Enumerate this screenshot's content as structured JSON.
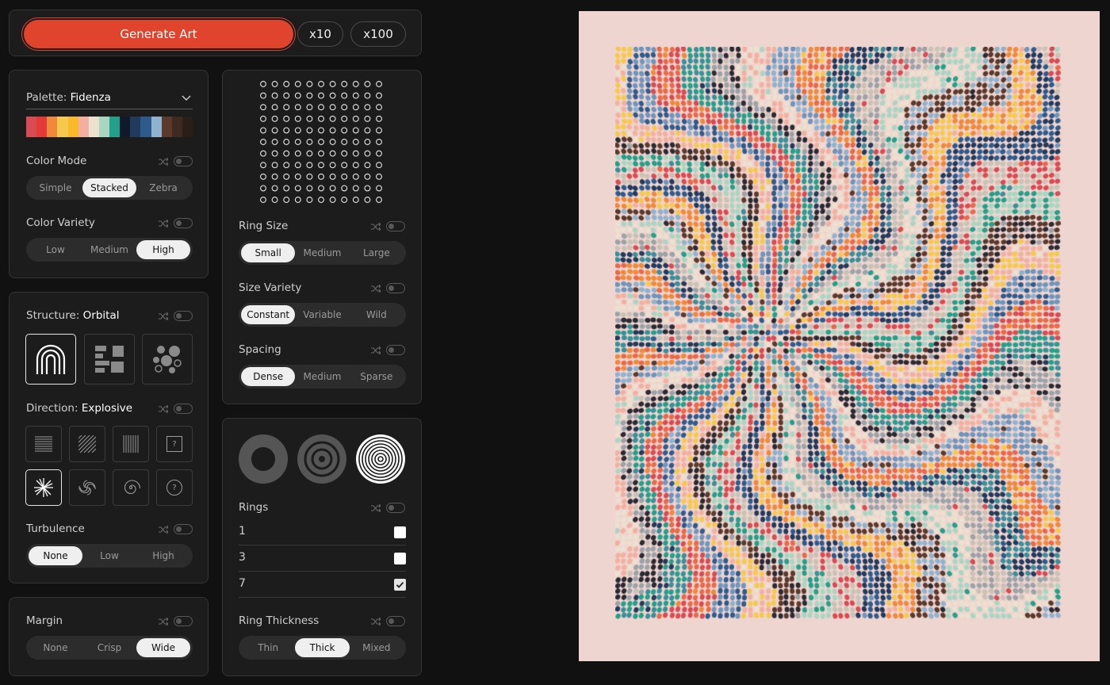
{
  "toolbar": {
    "generate_label": "Generate Art",
    "x10_label": "x10",
    "x100_label": "x100"
  },
  "palette": {
    "label": "Palette:",
    "value": "Fidenza",
    "swatches": [
      "#d94b52",
      "#e23a36",
      "#ef8a3a",
      "#f6c94e",
      "#f9b928",
      "#f2b1a0",
      "#ece0cf",
      "#a9d6c3",
      "#23a08a",
      "#101a2a",
      "#223a5c",
      "#2f5b8c",
      "#8fb3cf",
      "#5b3a2c",
      "#3f2a20",
      "#2a1e18"
    ]
  },
  "color_mode": {
    "label": "Color Mode",
    "options": [
      "Simple",
      "Stacked",
      "Zebra"
    ],
    "selected": "Stacked"
  },
  "color_variety": {
    "label": "Color Variety",
    "options": [
      "Low",
      "Medium",
      "High"
    ],
    "selected": "High"
  },
  "structure": {
    "label": "Structure:",
    "value": "Orbital"
  },
  "direction": {
    "label": "Direction:",
    "value": "Explosive",
    "unknown_glyph": "?"
  },
  "turbulence": {
    "label": "Turbulence",
    "options": [
      "None",
      "Low",
      "High"
    ],
    "selected": "None"
  },
  "margin": {
    "label": "Margin",
    "options": [
      "None",
      "Crisp",
      "Wide"
    ],
    "selected": "Wide"
  },
  "ring_size": {
    "label": "Ring Size",
    "options": [
      "Small",
      "Medium",
      "Large"
    ],
    "selected": "Small"
  },
  "size_variety": {
    "label": "Size Variety",
    "options": [
      "Constant",
      "Variable",
      "Wild"
    ],
    "selected": "Constant"
  },
  "spacing": {
    "label": "Spacing",
    "options": [
      "Dense",
      "Medium",
      "Sparse"
    ],
    "selected": "Dense"
  },
  "rings": {
    "label": "Rings",
    "items": [
      {
        "label": "1",
        "checked": false
      },
      {
        "label": "3",
        "checked": false
      },
      {
        "label": "7",
        "checked": true
      }
    ]
  },
  "ring_thickness": {
    "label": "Ring Thickness",
    "options": [
      "Thin",
      "Thick",
      "Mixed"
    ],
    "selected": "Thick"
  },
  "artwork": {
    "background": "#efd5d0",
    "dot_colors": [
      "#d94b52",
      "#e86a4a",
      "#ef8a3a",
      "#f6c94e",
      "#f2b1a0",
      "#ece0cf",
      "#a9d6c3",
      "#23a08a",
      "#3a8f9a",
      "#223a5c",
      "#2f5b8c",
      "#6f95bd",
      "#8fb3cf",
      "#5b3a2c",
      "#2a2a33",
      "#9aa3a8",
      "#c9c2b5"
    ]
  }
}
